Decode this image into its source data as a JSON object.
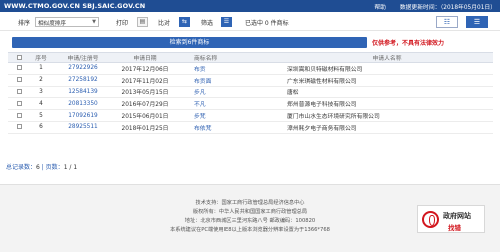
{
  "header": {
    "domain": "WWW.CTMO.GOV.CN SBJ.SAIC.GOV.CN",
    "help": "帮助",
    "update_date": "数据更新时间：（2018年05月01日）"
  },
  "toolbar": {
    "sort_label": "排序",
    "sort_value": "相似度排序",
    "print": "打印",
    "compare": "比对",
    "filter": "筛选",
    "selected_text": "已选中 0 件商标"
  },
  "banner": {
    "text": "检索到6件商标",
    "warning": "仅供参考，不具有法律效力"
  },
  "table": {
    "headers": [
      "序号",
      "申请/注册号",
      "申请日期",
      "商标名称",
      "申请人名称"
    ],
    "rows": [
      {
        "no": "1",
        "reg": "27922926",
        "date": "2017年12月06日",
        "name": "布贡",
        "applicant": "深圳嵩和贝特磁材料有限公司"
      },
      {
        "no": "2",
        "reg": "27258192",
        "date": "2017年11月02日",
        "name": "布贡面",
        "applicant": "广东米琪磁性材料有限公司"
      },
      {
        "no": "3",
        "reg": "12584139",
        "date": "2013年05月15日",
        "name": "步凡",
        "applicant": "唐松"
      },
      {
        "no": "4",
        "reg": "20813350",
        "date": "2016年07月29日",
        "name": "不凡",
        "applicant": "郑州普源电子科技有限公司"
      },
      {
        "no": "5",
        "reg": "17092619",
        "date": "2015年06月01日",
        "name": "步梵",
        "applicant": "厦门市山水生态环境研究所有限公司"
      },
      {
        "no": "6",
        "reg": "28925511",
        "date": "2018年01月25日",
        "name": "布依梵",
        "applicant": "漳州耗夕电子商务有限公司"
      }
    ]
  },
  "pager": {
    "total_label": "总记录数：",
    "total": "6",
    "page_label": " | 页数：",
    "page": "1 / 1"
  },
  "footer": {
    "line1": "技术支持：国家工商行政管理总局经济信息中心",
    "line2": "版权所有：中华人民共和国国家工商行政管理总局",
    "line3": "地址：北京市西城区三里河东路八号  邮政编码：100820",
    "line4": "本系统建议在PC端使用IE8以上版本浏览器分辨率设置为于1366*768"
  },
  "badge": {
    "title": "政府网站",
    "subtitle": "找错"
  }
}
